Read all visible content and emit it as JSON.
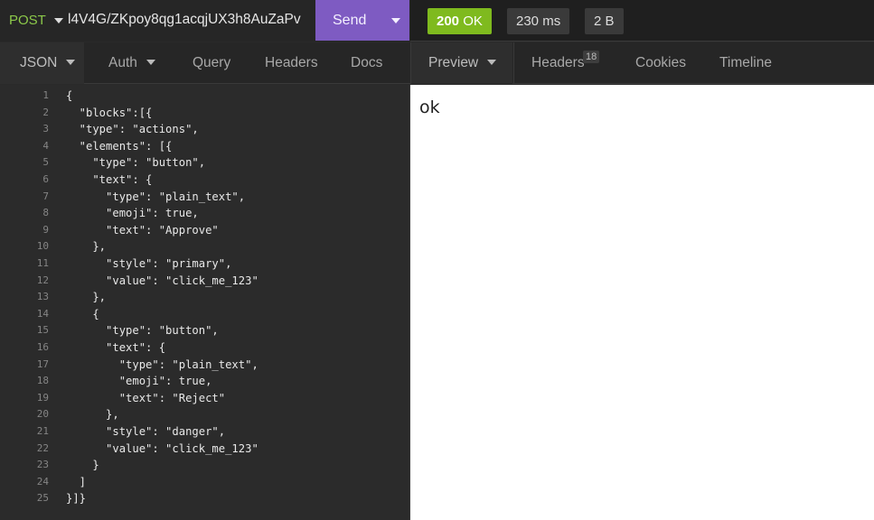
{
  "request": {
    "method": "POST",
    "url": "l4V4G/ZKpoy8qg1acqjUX3h8AuZaPv",
    "send_label": "Send"
  },
  "response_meta": {
    "status_code": "200",
    "status_text": "OK",
    "time": "230 ms",
    "size": "2 B"
  },
  "request_tabs": [
    {
      "label": "JSON",
      "dropdown": true,
      "active": true
    },
    {
      "label": "Auth",
      "dropdown": true
    },
    {
      "label": "Query"
    },
    {
      "label": "Headers"
    },
    {
      "label": "Docs"
    }
  ],
  "response_tabs": [
    {
      "label": "Preview",
      "dropdown": true,
      "active": true
    },
    {
      "label": "Headers",
      "count": "18"
    },
    {
      "label": "Cookies"
    },
    {
      "label": "Timeline"
    }
  ],
  "body_lines": [
    "{",
    "  \"blocks\":[{",
    "  \"type\": \"actions\",",
    "  \"elements\": [{",
    "    \"type\": \"button\",",
    "    \"text\": {",
    "      \"type\": \"plain_text\",",
    "      \"emoji\": true,",
    "      \"text\": \"Approve\"",
    "    },",
    "      \"style\": \"primary\",",
    "      \"value\": \"click_me_123\"",
    "    },",
    "    {",
    "      \"type\": \"button\",",
    "      \"text\": {",
    "        \"type\": \"plain_text\",",
    "        \"emoji\": true,",
    "        \"text\": \"Reject\"",
    "      },",
    "      \"style\": \"danger\",",
    "      \"value\": \"click_me_123\"",
    "    }",
    "  ]",
    "}]}"
  ],
  "response_body": "ok",
  "colors": {
    "method": "#8cc94a",
    "send": "#7e5bc2",
    "status_ok": "#7fba1e"
  }
}
